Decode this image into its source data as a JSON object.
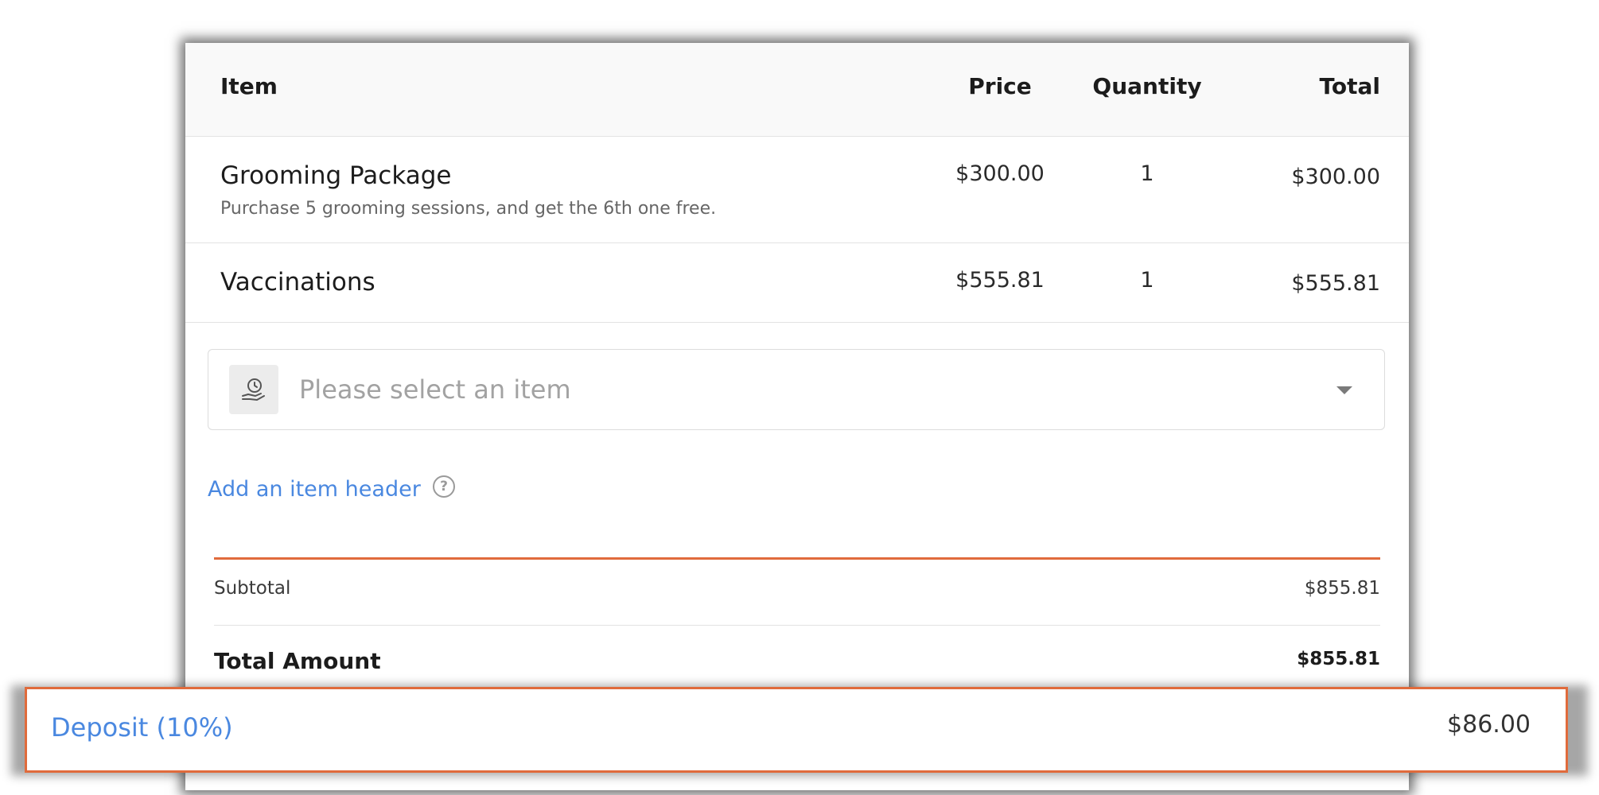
{
  "table": {
    "headers": {
      "item": "Item",
      "price": "Price",
      "quantity": "Quantity",
      "total": "Total"
    },
    "rows": [
      {
        "name": "Grooming Package",
        "description": "Purchase 5 grooming sessions, and get the 6th one free.",
        "price": "$300.00",
        "quantity": "1",
        "total": "$300.00"
      },
      {
        "name": "Vaccinations",
        "description": "",
        "price": "$555.81",
        "quantity": "1",
        "total": "$555.81"
      }
    ]
  },
  "item_select": {
    "placeholder": "Please select an item",
    "icon": "hand-clock-icon"
  },
  "add_item_header": {
    "label": "Add an item header",
    "help_icon": "help-circle-icon",
    "help_glyph": "?"
  },
  "summary": {
    "subtotal_label": "Subtotal",
    "subtotal_value": "$855.81",
    "total_label": "Total Amount",
    "total_value": "$855.81"
  },
  "deposit": {
    "label": "Deposit (10%)",
    "value": "$86.00"
  },
  "colors": {
    "accent_orange": "#e06b3c",
    "link_blue": "#4a88e0"
  }
}
